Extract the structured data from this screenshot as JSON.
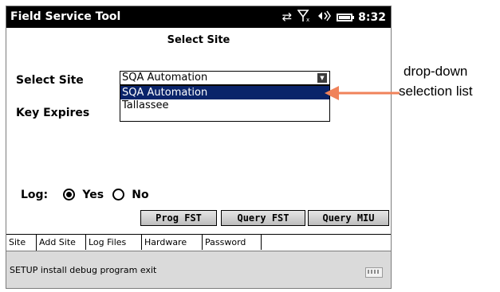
{
  "app": {
    "title": "Field Service Tool",
    "time": "8:32"
  },
  "status_icons": [
    "sync-arrows-icon",
    "signal-off-icon",
    "speaker-icon",
    "battery-icon"
  ],
  "page": {
    "heading": "Select Site"
  },
  "form": {
    "select_site_label": "Select Site",
    "key_expires_label": "Key Expires",
    "site_value": "SQA Automation",
    "site_options": [
      "SQA Automation",
      "Tallassee"
    ],
    "selected_option_index": 0
  },
  "log": {
    "label": "Log:",
    "options": [
      "Yes",
      "No"
    ],
    "selected": "Yes"
  },
  "buttons": {
    "prog_fst": "Prog FST",
    "query_fst": "Query FST",
    "query_miu": "Query MIU"
  },
  "tabs": [
    "Site",
    "Add Site",
    "Log Files",
    "Hardware",
    "Password"
  ],
  "active_tab": "Site",
  "command_bar": {
    "text": "SETUP install debug program exit"
  },
  "annotation": {
    "line1": "drop-down",
    "line2": "selection list",
    "arrow_color": "#f0825a"
  },
  "colors": {
    "title_bar": "#000000",
    "selection": "#0a246a",
    "command_bar": "#dadada"
  }
}
